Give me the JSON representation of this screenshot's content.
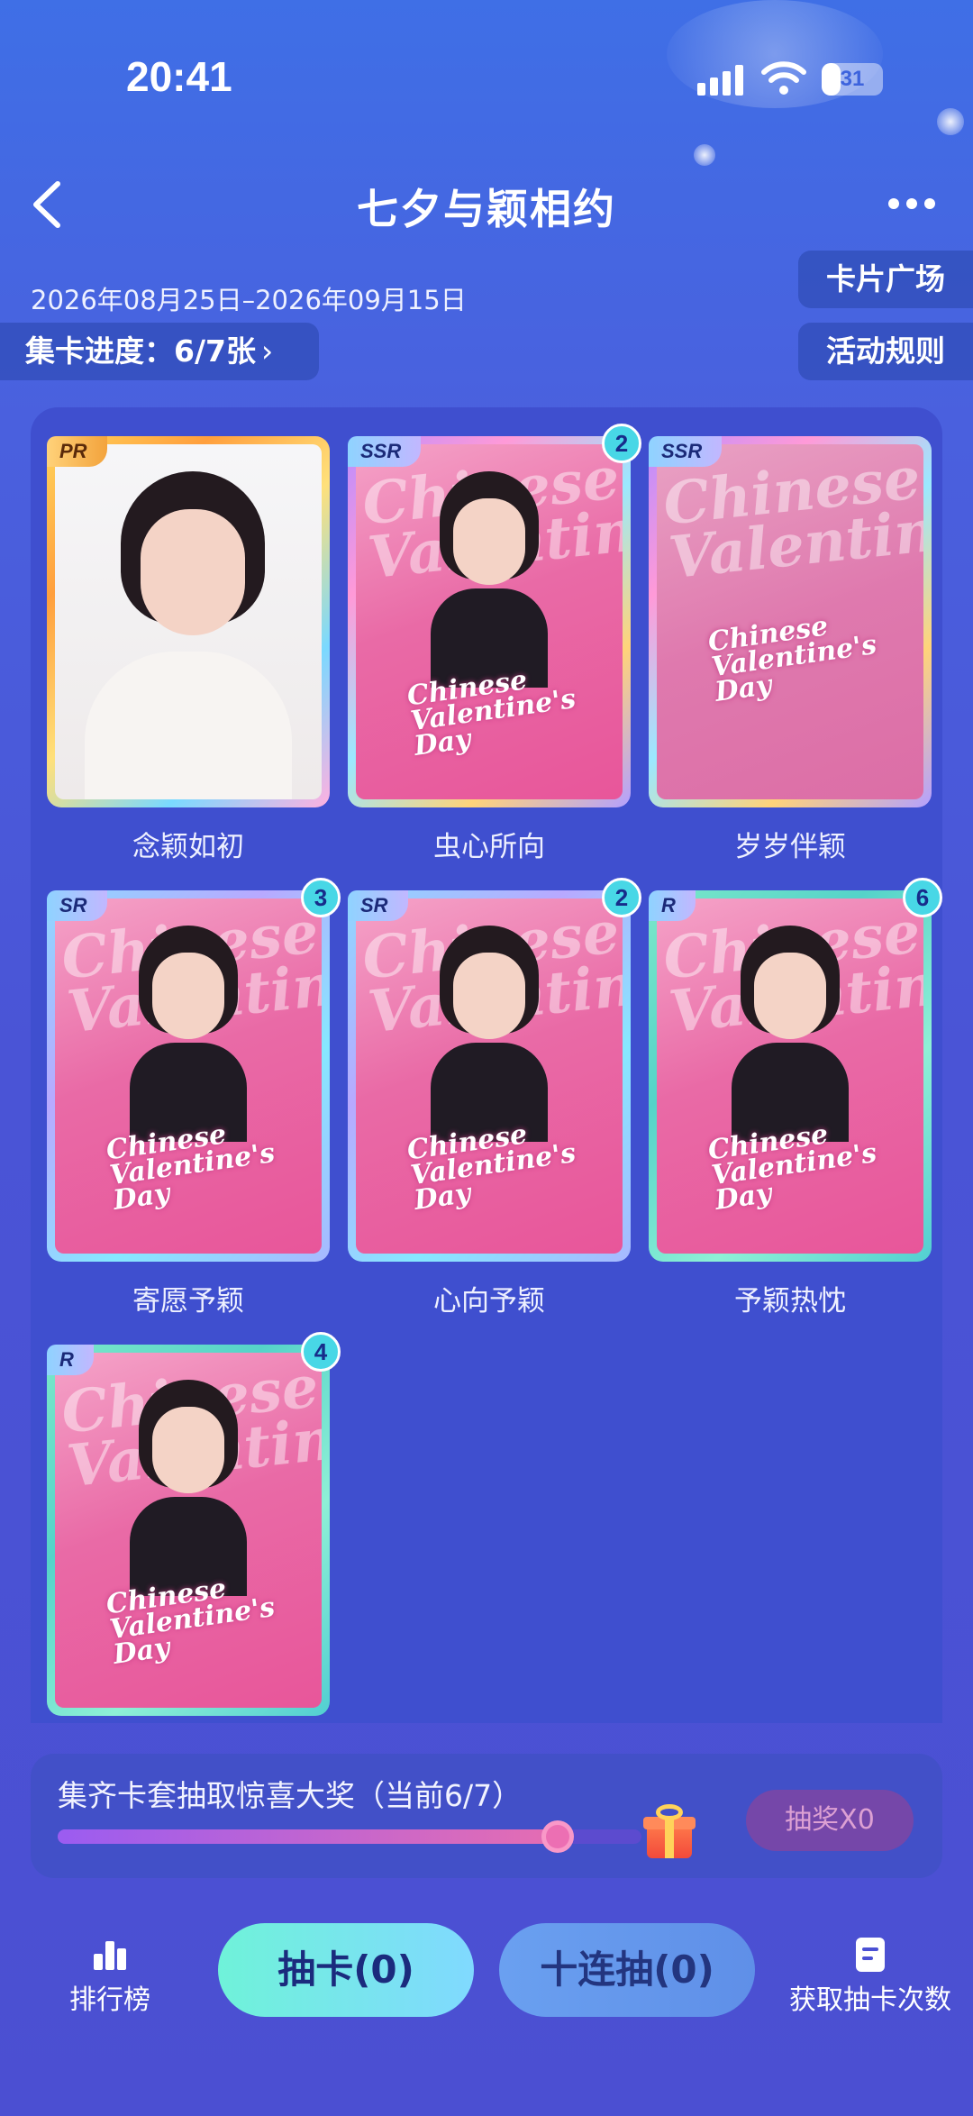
{
  "status_bar": {
    "time": "20:41",
    "battery": "31",
    "battery_level": 0.31
  },
  "nav": {
    "title": "七夕与颖相约"
  },
  "event": {
    "date_range": "2026年08月25日–2026年09月15日",
    "progress_label": "集卡进度：6/7张",
    "card_square": "卡片广场",
    "rules": "活动规则"
  },
  "cards": [
    {
      "name": "念颖如初",
      "rarity": "PR",
      "count": ""
    },
    {
      "name": "虫心所向",
      "rarity": "SSR",
      "count": "2"
    },
    {
      "name": "岁岁伴颖",
      "rarity": "SSR",
      "count": ""
    },
    {
      "name": "寄愿予颖",
      "rarity": "SR",
      "count": "3"
    },
    {
      "name": "心向予颖",
      "rarity": "SR",
      "count": "2"
    },
    {
      "name": "予颖热忱",
      "rarity": "R",
      "count": "6"
    },
    {
      "name": "",
      "rarity": "R",
      "count": "4"
    }
  ],
  "card_art": {
    "script_bg": "Chinese Valentine",
    "script_fg": "Chinese Valentine's Day"
  },
  "reward": {
    "title": "集齐卡套抽取惊喜大奖（当前6/7）",
    "progress": 0.857,
    "lottery_button": "抽奖X0"
  },
  "footer": {
    "ranking": "排行榜",
    "draw_one": "抽卡(0)",
    "draw_ten": "十连抽(0)",
    "get_draws": "获取抽卡次数"
  },
  "colors": {
    "accent_teal": "#48d7e6",
    "background": "#4a54d6",
    "card_pink": "#e8569a"
  },
  "icons": [
    "back-icon",
    "more-icon",
    "chevron-right-icon",
    "gift-icon",
    "ranking-icon",
    "get-draws-icon",
    "signal-icon",
    "wifi-icon",
    "battery-icon"
  ]
}
